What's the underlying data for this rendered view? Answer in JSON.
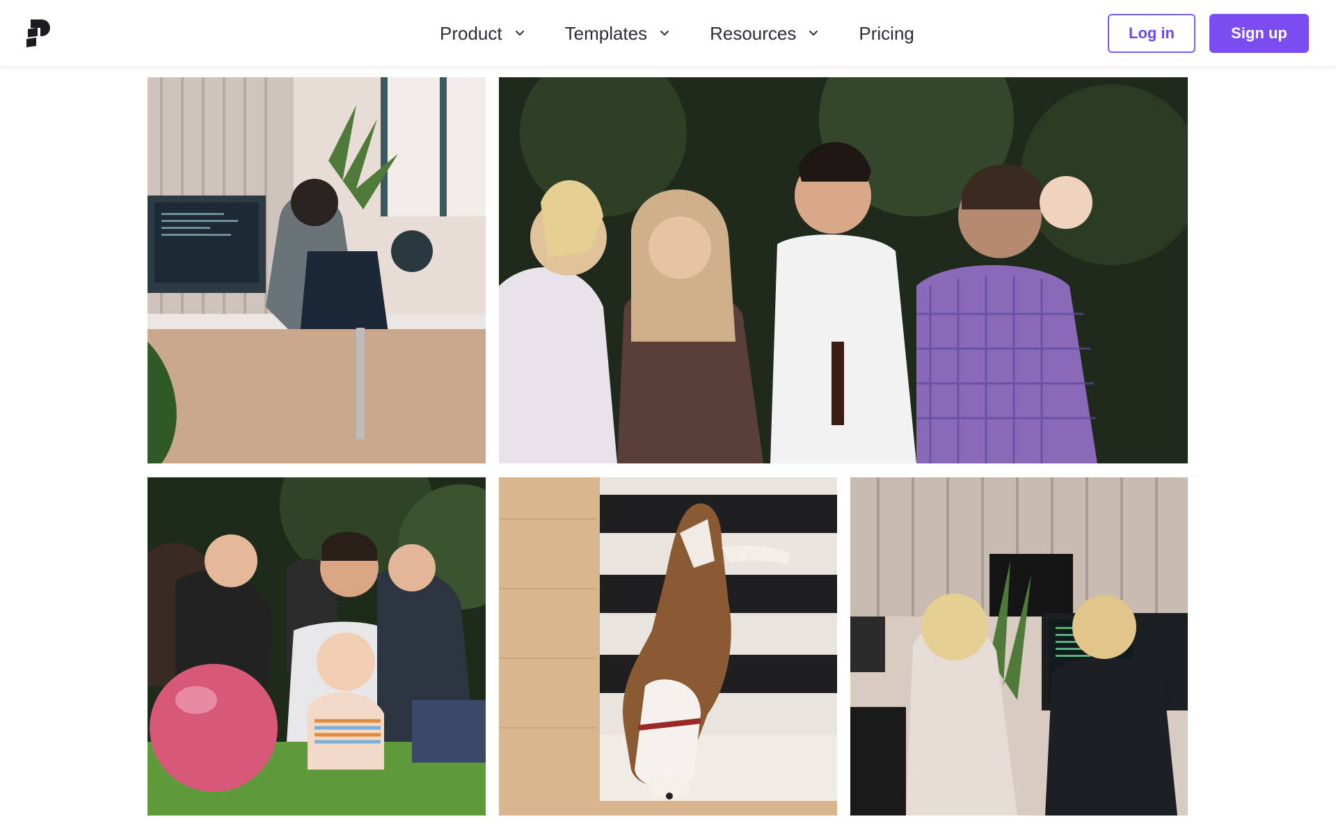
{
  "header": {
    "logo_icon": "brand-logo-icon",
    "nav": [
      {
        "label": "Product",
        "has_dropdown": true
      },
      {
        "label": "Templates",
        "has_dropdown": true
      },
      {
        "label": "Resources",
        "has_dropdown": true
      },
      {
        "label": "Pricing",
        "has_dropdown": false
      }
    ],
    "login_label": "Log in",
    "signup_label": "Sign up"
  },
  "colors": {
    "accent": "#7b4df1",
    "nav_text": "#2d2d38",
    "background": "#ffffff"
  },
  "gallery": {
    "photos": [
      {
        "subject": "office-coder-at-desk"
      },
      {
        "subject": "friends-chatting-outdoors"
      },
      {
        "subject": "picnic-crowd-with-baby-and-ball"
      },
      {
        "subject": "dog-lying-on-striped-rug"
      },
      {
        "subject": "team-working-at-monitors"
      }
    ]
  }
}
